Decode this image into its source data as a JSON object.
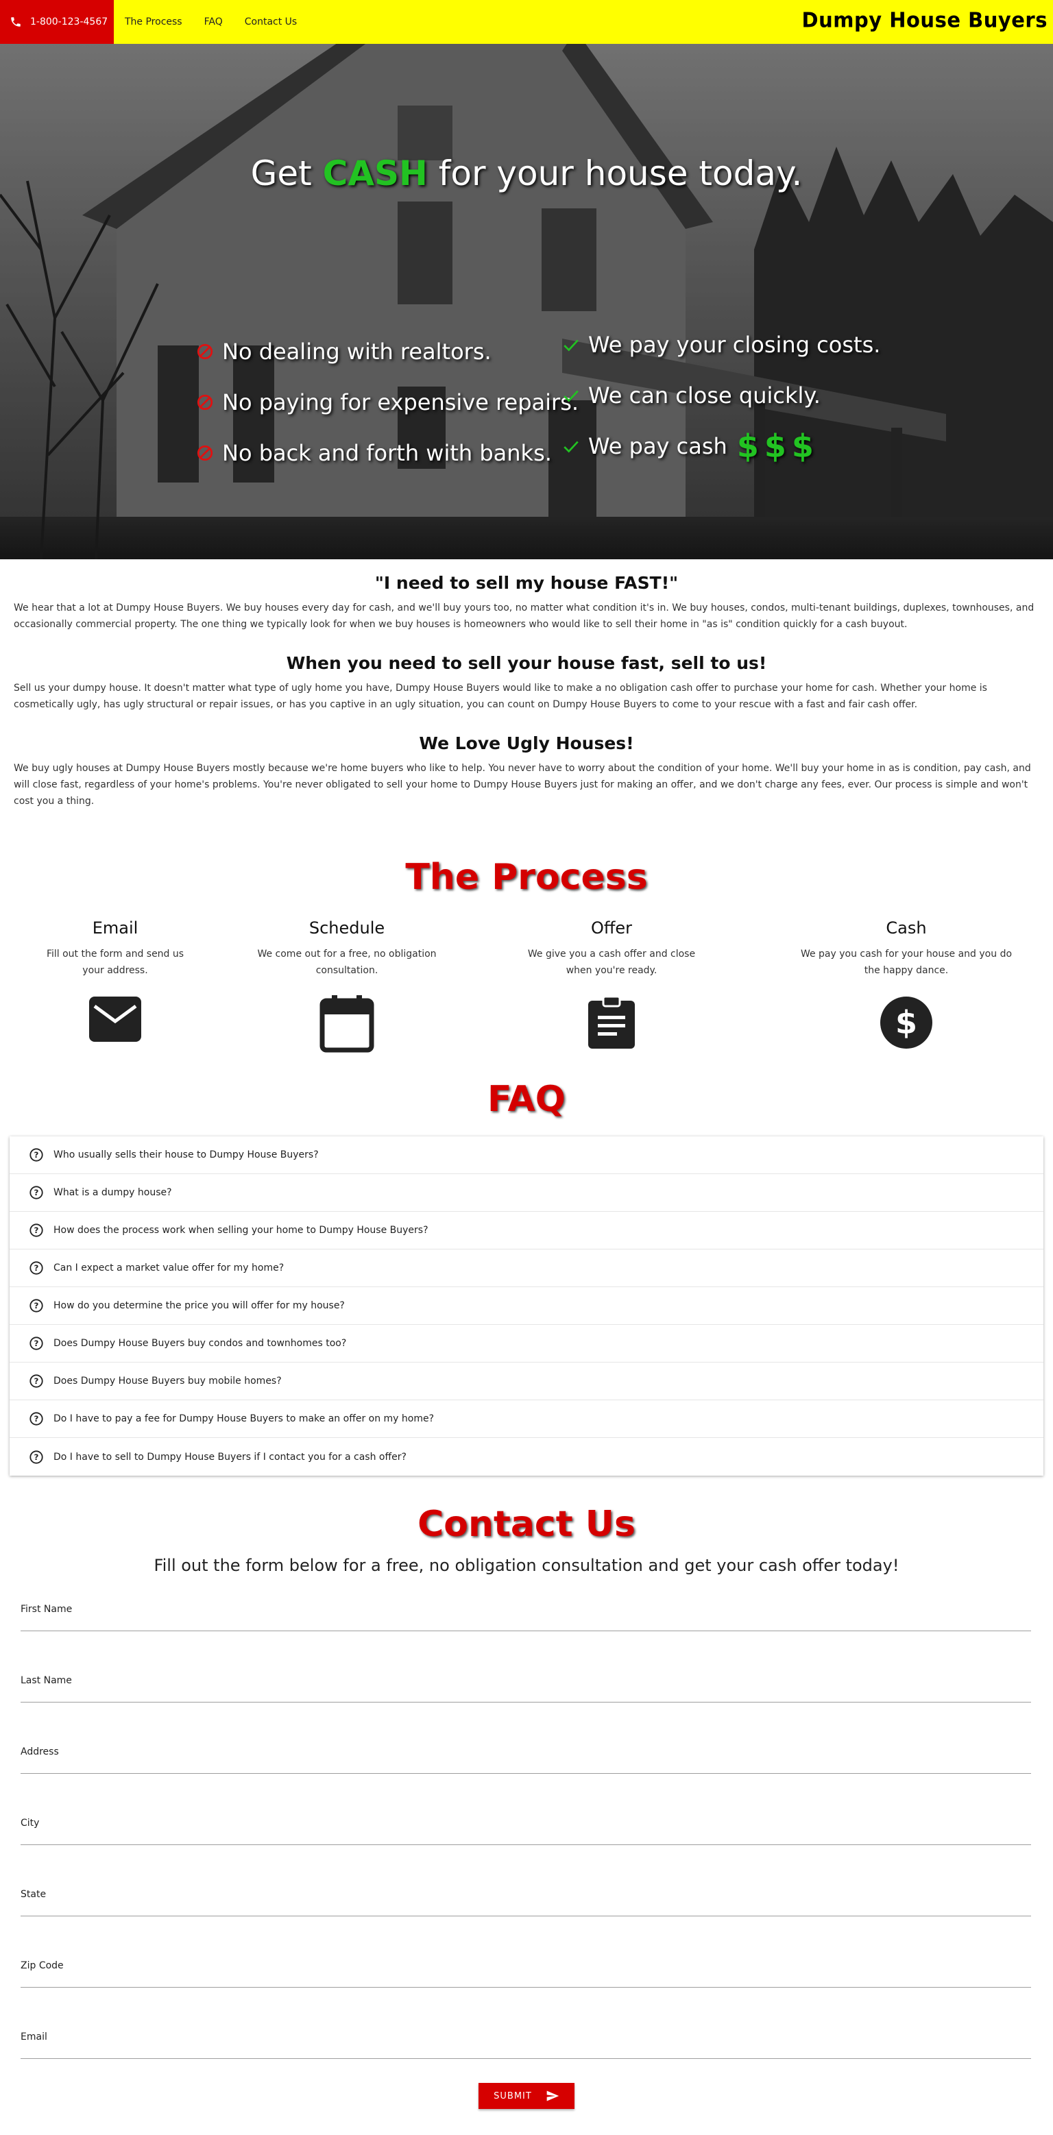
{
  "nav": {
    "phone": "1-800-123-4567",
    "links": [
      "The Process",
      "FAQ",
      "Contact Us"
    ],
    "brand": "Dumpy House Buyers"
  },
  "hero": {
    "title_pre": "Get ",
    "title_cash": "CASH",
    "title_post": " for your house today.",
    "left_items": [
      "No dealing with realtors.",
      "No paying for expensive repairs.",
      "No back and forth with banks."
    ],
    "right_items": [
      "We pay your closing costs.",
      "We can close quickly.",
      "We pay cash"
    ],
    "dollars": "$$$"
  },
  "sections": [
    {
      "heading": "\"I need to sell my house FAST!\"",
      "body": "We hear that a lot at Dumpy House Buyers. We buy houses every day for cash, and we'll buy yours too, no matter what condition it's in. We buy houses, condos, multi-tenant buildings, duplexes, townhouses, and occasionally commercial property. The one thing we typically look for when we buy houses is homeowners who would like to sell their home in \"as is\" condition quickly for a cash buyout."
    },
    {
      "heading": "When you need to sell your house fast, sell to us!",
      "body": "Sell us your dumpy house. It doesn't matter what type of ugly home you have, Dumpy House Buyers would like to make a no obligation cash offer to purchase your home for cash. Whether your home is cosmetically ugly, has ugly structural or repair issues, or has you captive in an ugly situation, you can count on Dumpy House Buyers to come to your rescue with a fast and fair cash offer."
    },
    {
      "heading": "We Love Ugly Houses!",
      "body": "We buy ugly houses at Dumpy House Buyers mostly because we're home buyers who like to help. You never have to worry about the condition of your home. We'll buy your home in as is condition, pay cash, and will close fast, regardless of your home's problems. You're never obligated to sell your home to Dumpy House Buyers just for making an offer, and we don't charge any fees, ever. Our process is simple and won't cost you a thing."
    }
  ],
  "process": {
    "title": "The Process",
    "steps": [
      {
        "title": "Email",
        "desc": "Fill out the form and send us your address.",
        "icon": "email-icon"
      },
      {
        "title": "Schedule",
        "desc": "We come out for a free, no obligation consultation.",
        "icon": "calendar-icon"
      },
      {
        "title": "Offer",
        "desc": "We give you a cash offer and close when you're ready.",
        "icon": "clipboard-icon"
      },
      {
        "title": "Cash",
        "desc": "We pay you cash for your house and you do the happy dance.",
        "icon": "dollar-icon"
      }
    ]
  },
  "faq": {
    "title": "FAQ",
    "items": [
      "Who usually sells their house to Dumpy House Buyers?",
      "What is a dumpy house?",
      "How does the process work when selling your home to Dumpy House Buyers?",
      "Can I expect a market value offer for my home?",
      "How do you determine the price you will offer for my house?",
      "Does Dumpy House Buyers buy condos and townhomes too?",
      "Does Dumpy House Buyers buy mobile homes?",
      "Do I have to pay a fee for Dumpy House Buyers to make an offer on my home?",
      "Do I have to sell to Dumpy House Buyers if I contact you for a cash offer?"
    ]
  },
  "contact": {
    "title": "Contact Us",
    "subtitle": "Fill out the form below for a free, no obligation consultation and get your cash offer today!",
    "fields": [
      "First Name",
      "Last Name",
      "Address",
      "City",
      "State",
      "Zip Code",
      "Email"
    ],
    "submit": "SUBMIT"
  },
  "colors": {
    "nav_bg": "#ffff00",
    "accent_red": "#d60000",
    "cash_green": "#22c322"
  }
}
